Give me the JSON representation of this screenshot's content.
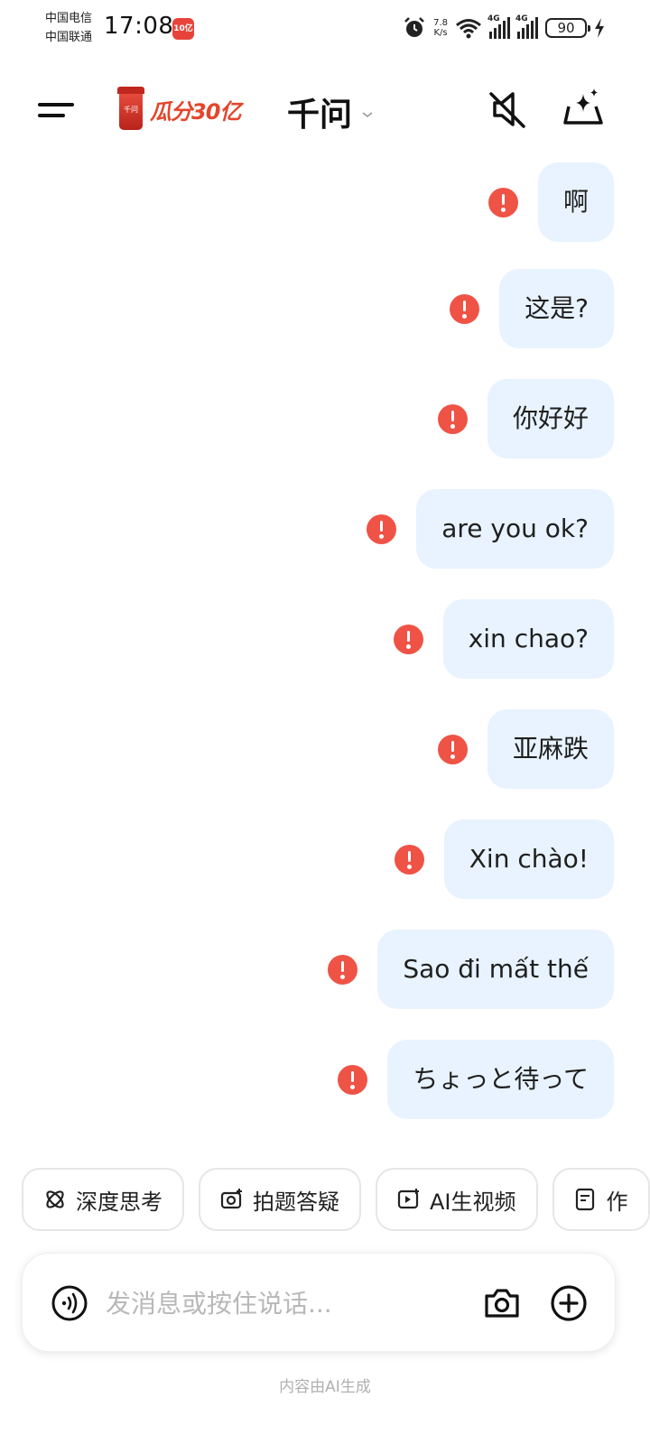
{
  "status_bar": {
    "carrier_1": "中国电信",
    "carrier_2": "中国联通",
    "time": "17:08",
    "app_badge": "10亿",
    "net_speed_value": "7.8",
    "net_speed_unit": "K/s",
    "sim1_label": "4G",
    "sim2_label": "4G",
    "battery": "90"
  },
  "header": {
    "promo_text": "瓜分30亿",
    "model_name": "千问",
    "icons": [
      "menu-icon",
      "mute-icon",
      "new-chat-sparkle-icon",
      "chevron-down-icon"
    ]
  },
  "messages": [
    {
      "text": "啊",
      "status": "failed"
    },
    {
      "text": "这是?",
      "status": "failed"
    },
    {
      "text": "你好好",
      "status": "failed"
    },
    {
      "text": "are you ok?",
      "status": "failed"
    },
    {
      "text": "xin chao?",
      "status": "failed"
    },
    {
      "text": "亚麻跌",
      "status": "failed"
    },
    {
      "text": "Xin chào!",
      "status": "failed"
    },
    {
      "text": "Sao đi mất thế",
      "status": "failed"
    },
    {
      "text": "ちょっと待って",
      "status": "failed"
    }
  ],
  "chips": [
    {
      "label": "深度思考",
      "icon": "deep-think-icon"
    },
    {
      "label": "拍题答疑",
      "icon": "photo-question-icon"
    },
    {
      "label": "AI生视频",
      "icon": "ai-video-icon"
    },
    {
      "label": "作",
      "icon": "doc-icon"
    }
  ],
  "input": {
    "placeholder": "发消息或按住说话..."
  },
  "footer": {
    "disclaimer": "内容由AI生成"
  },
  "colors": {
    "bubble_bg": "#e8f3ff",
    "error_red": "#ee5346",
    "promo_red": "#e3462c"
  }
}
